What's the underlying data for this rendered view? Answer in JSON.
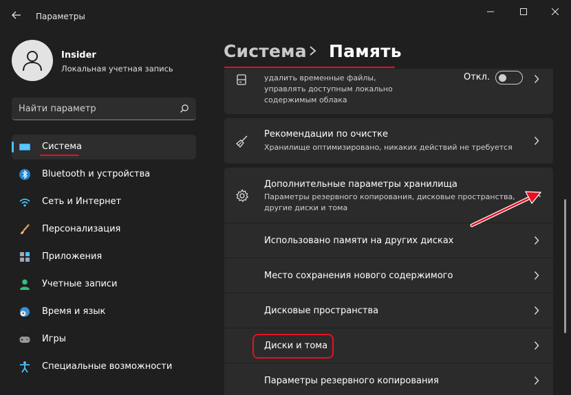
{
  "window": {
    "title": "Параметры"
  },
  "user": {
    "name": "Insider",
    "account_type": "Локальная учетная запись"
  },
  "search": {
    "placeholder": "Найти параметр"
  },
  "sidebar": {
    "items": [
      {
        "label": "Система",
        "icon": "monitor-icon",
        "active": true
      },
      {
        "label": "Bluetooth и устройства",
        "icon": "bluetooth-icon"
      },
      {
        "label": "Сеть и Интернет",
        "icon": "wifi-icon"
      },
      {
        "label": "Персонализация",
        "icon": "brush-icon"
      },
      {
        "label": "Приложения",
        "icon": "apps-icon"
      },
      {
        "label": "Учетные записи",
        "icon": "person-icon"
      },
      {
        "label": "Время и язык",
        "icon": "globe-clock-icon"
      },
      {
        "label": "Игры",
        "icon": "gamepad-icon"
      },
      {
        "label": "Специальные возможности",
        "icon": "accessibility-icon"
      }
    ]
  },
  "breadcrumb": {
    "parent": "Система",
    "current": "Память"
  },
  "cards": {
    "storage_sense": {
      "desc_lines": [
        "удалить временные файлы,",
        "управлять доступным локально",
        "содержимым облака"
      ],
      "toggle_label": "Откл.",
      "toggle_on": false
    },
    "cleanup": {
      "title": "Рекомендации по очистке",
      "desc": "Хранилище оптимизировано, никаких действий не требуется"
    },
    "advanced": {
      "title": "Дополнительные параметры хранилища",
      "desc_lines": [
        "Параметры резервного копирования, дисковые пространства,",
        "другие диски и тома"
      ],
      "expanded": true
    },
    "sub_items": [
      "Использовано памяти на других дисках",
      "Место сохранения нового содержимого",
      "Дисковые пространства",
      "Диски и тома",
      "Параметры резервного копирования"
    ]
  },
  "colors": {
    "accent": "#4cc2ff",
    "annotation_red": "#e81123",
    "card_bg": "#2b2b2b",
    "window_bg": "#1f1f1f"
  }
}
